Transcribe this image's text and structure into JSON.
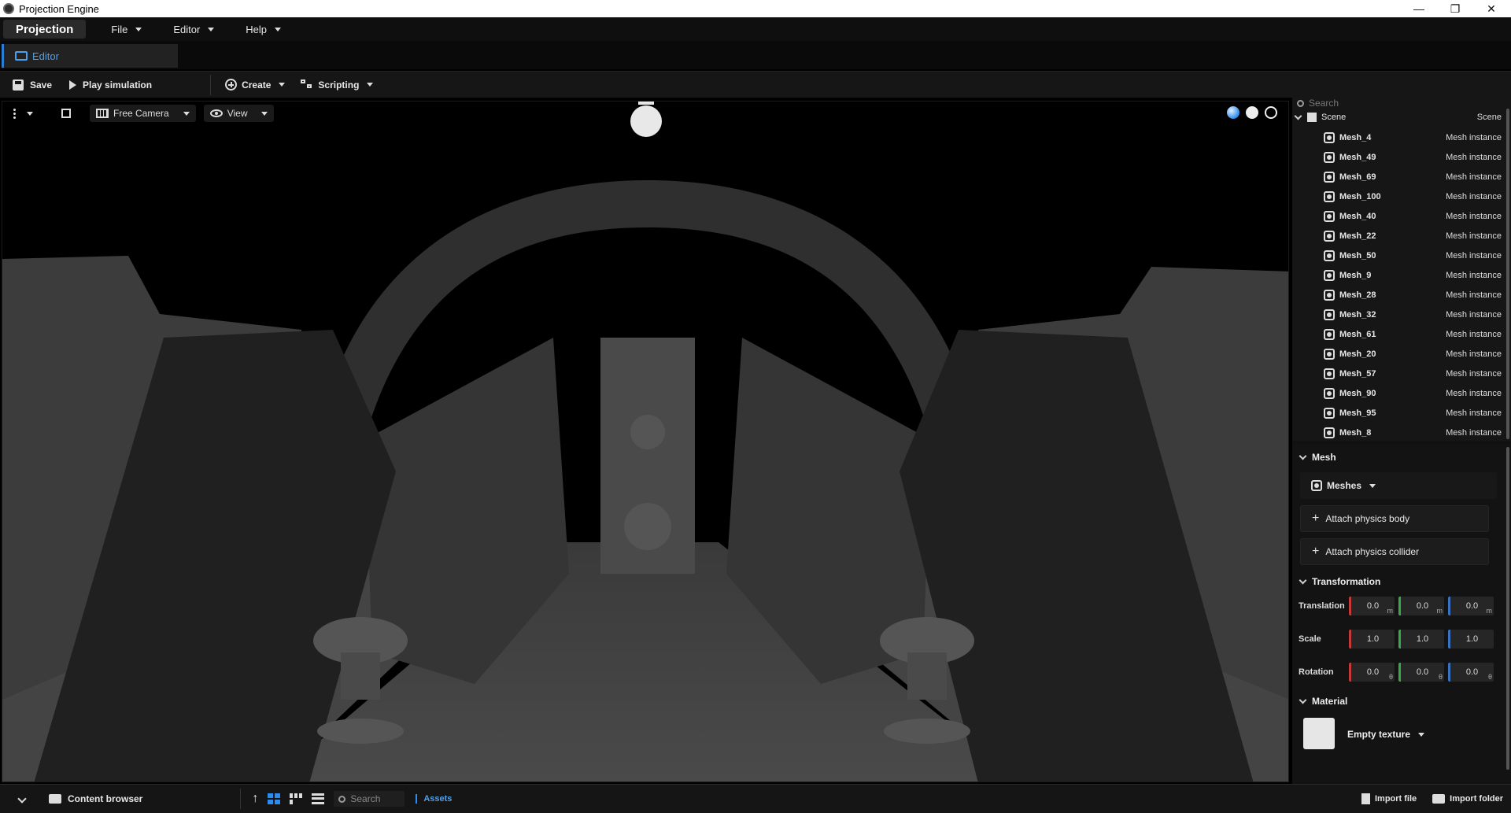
{
  "window": {
    "title": "Projection Engine",
    "controls": [
      "—",
      "❐",
      "✕"
    ]
  },
  "menubar": {
    "brand": "Projection",
    "items": [
      "File",
      "Editor",
      "Help"
    ]
  },
  "tabs": {
    "editor": "Editor"
  },
  "toolbar": {
    "save": "Save",
    "play": "Play simulation",
    "create": "Create",
    "scripting": "Scripting"
  },
  "viewport": {
    "camera": "Free Camera",
    "view": "View",
    "shading_modes": [
      "lit-sphere-icon",
      "solid-sphere-icon",
      "wireframe-globe-icon"
    ]
  },
  "hierarchy": {
    "search_placeholder": "Search",
    "scene_name": "Scene",
    "scene_type": "Scene",
    "items": [
      {
        "name": "Mesh_4",
        "type": "Mesh instance"
      },
      {
        "name": "Mesh_49",
        "type": "Mesh instance"
      },
      {
        "name": "Mesh_69",
        "type": "Mesh instance"
      },
      {
        "name": "Mesh_100",
        "type": "Mesh instance"
      },
      {
        "name": "Mesh_40",
        "type": "Mesh instance"
      },
      {
        "name": "Mesh_22",
        "type": "Mesh instance"
      },
      {
        "name": "Mesh_50",
        "type": "Mesh instance"
      },
      {
        "name": "Mesh_9",
        "type": "Mesh instance"
      },
      {
        "name": "Mesh_28",
        "type": "Mesh instance"
      },
      {
        "name": "Mesh_32",
        "type": "Mesh instance"
      },
      {
        "name": "Mesh_61",
        "type": "Mesh instance"
      },
      {
        "name": "Mesh_20",
        "type": "Mesh instance"
      },
      {
        "name": "Mesh_57",
        "type": "Mesh instance"
      },
      {
        "name": "Mesh_90",
        "type": "Mesh instance"
      },
      {
        "name": "Mesh_95",
        "type": "Mesh instance"
      },
      {
        "name": "Mesh_8",
        "type": "Mesh instance"
      }
    ]
  },
  "inspector": {
    "mesh_title": "Mesh",
    "meshes_select": "Meshes",
    "attach_body": "Attach physics body",
    "attach_collider": "Attach physics collider",
    "transform_title": "Transformation",
    "translation_label": "Translation",
    "translation": [
      "0.0",
      "0.0",
      "0.0"
    ],
    "translation_unit": "m",
    "scale_label": "Scale",
    "scale": [
      "1.0",
      "1.0",
      "1.0"
    ],
    "rotation_label": "Rotation",
    "rotation": [
      "0.0",
      "0.0",
      "0.0"
    ],
    "rotation_unit": "θ",
    "material_title": "Material",
    "texture_select": "Empty texture"
  },
  "bottombar": {
    "content_browser": "Content browser",
    "search_placeholder": "Search",
    "assets_tab": "Assets",
    "import_file": "Import file",
    "import_folder": "Import folder"
  },
  "colors": {
    "accent": "#2d8cf0",
    "x_axis": "#c23a3a",
    "y_axis": "#3aa84a",
    "z_axis": "#3a72c2"
  }
}
